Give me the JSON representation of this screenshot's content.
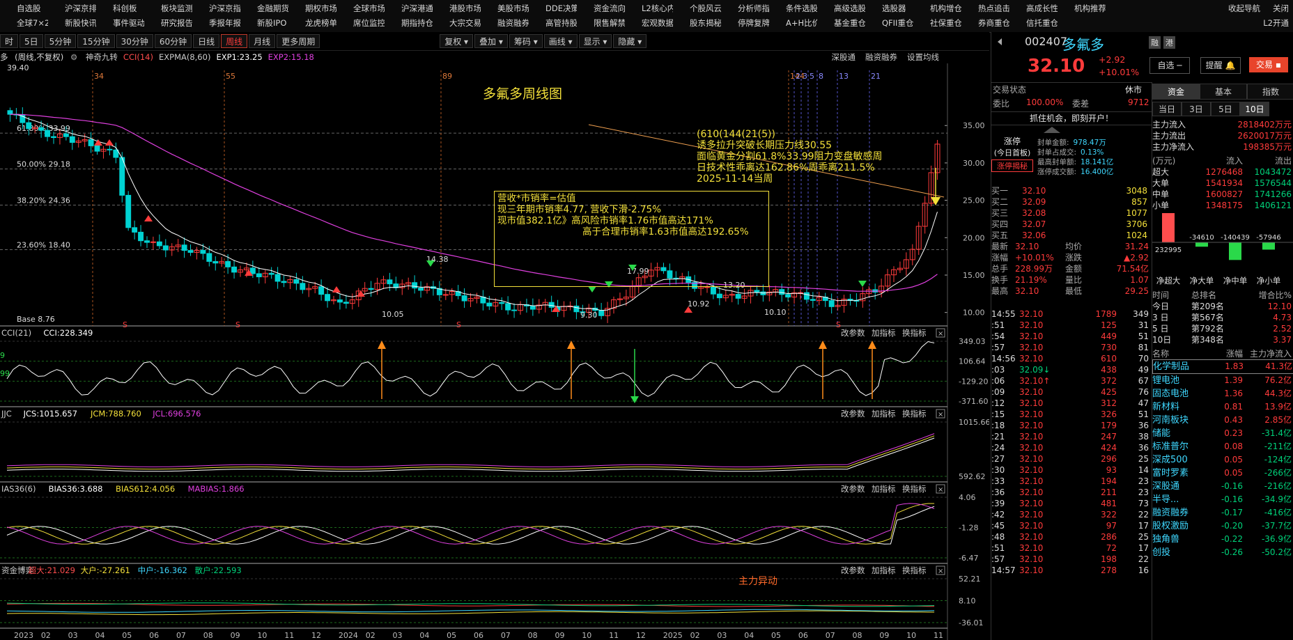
{
  "menu": {
    "row1": [
      "自选股",
      "沪深京排行",
      "科创板",
      "板块监测",
      "沪深京指数",
      "金融期货",
      "期权市场",
      "全球市场",
      "沪深港通",
      "港股市场",
      "美股市场",
      "DDE决策",
      "资金流向",
      "L2核心内参",
      "个股风云",
      "分析师指数",
      "条件选股",
      "高级选股",
      "选股器",
      "机构增仓",
      "热点追击",
      "高成长性",
      "机构推荐"
    ],
    "row2": [
      "全球7×24",
      "新股快讯",
      "事件驱动",
      "研究报告",
      "季报年报",
      "新股IPO",
      "龙虎榜单",
      "席位监控",
      "期指持仓",
      "大宗交易",
      "融资融券",
      "高管持股",
      "限售解禁",
      "宏观数据",
      "股东揭秘",
      "停牌复牌",
      "A+H比价",
      "基金重仓",
      "QFII重仓",
      "社保重仓",
      "券商重仓",
      "信托重仓"
    ],
    "right1": [
      "收起导航",
      "关闭"
    ],
    "right2": [
      "L2开通"
    ]
  },
  "periods": [
    "时",
    "5日",
    "5分钟",
    "15分钟",
    "30分钟",
    "60分钟",
    "日线",
    "周线",
    "月线",
    "更多周期"
  ],
  "active_period": "周线",
  "tools": [
    "复权",
    "叠加",
    "筹码",
    "画线",
    "显示",
    "隐藏"
  ],
  "main_indicator": {
    "stock_short": "多",
    "mode": "(周线,不复权)",
    "items": [
      {
        "text": "神奇九转",
        "color": "#cccccc"
      },
      {
        "text": "CCI(14)",
        "color": "#ff4d4d"
      },
      {
        "text": "EXPMA(8,60)",
        "color": "#cccccc"
      },
      {
        "text": "EXP1:23.25",
        "color": "#ffffff"
      },
      {
        "text": "EXP2:15.18",
        "color": "#e040e0"
      }
    ],
    "links": [
      "深股通",
      "融资融券",
      "设置均线"
    ]
  },
  "chart_title": "多氟多周线图",
  "annotation_box": {
    "lines": [
      "营收*市销率=估值",
      "现三年期市销率4.77, 营收下滑-2.75%",
      "现市值382.1亿》高风险市销率1.76市值高达171%",
      "高于合理市销率1.63市值高达192.65%"
    ]
  },
  "analysis_text": [
    "(610(144(21(5))",
    "诱多拉升突破长期压力线30.55",
    "面临黄金分割61.8%33.99阻力变盘敏感周",
    "日技术性乖离达162.86%周乖离211.5%",
    "2025-11-14当周"
  ],
  "fib_levels": [
    {
      "label": "61.80% 33.99",
      "value": 33.99
    },
    {
      "label": "50.00% 29.18",
      "value": 29.18
    },
    {
      "label": "38.20% 24.36",
      "value": 24.36
    },
    {
      "label": "23.60% 18.40",
      "value": 18.4
    }
  ],
  "fib_top_label": "39.40",
  "base_label": "Base  8.76",
  "price_axis": [
    "35.00",
    "30.00",
    "25.00",
    "20.00",
    "15.00",
    "10.00"
  ],
  "fib_numbers": [
    "34",
    "55",
    "89",
    "144",
    "2",
    "3",
    "5",
    "8",
    "13",
    "21"
  ],
  "candle_marks": [
    "10.05",
    "14.38",
    "9.30",
    "17.99",
    "10.92",
    "13.20",
    "10.10"
  ],
  "panels": [
    {
      "name": "CCI",
      "items": [
        {
          "text": "CCI(21)",
          "color": "#cccccc"
        },
        {
          "text": "CCI:228.349",
          "color": "#ffffff"
        }
      ],
      "axis": [
        "349.03",
        "106.64",
        "-129.20",
        "-371.60"
      ],
      "left_labels": [
        "9",
        "99"
      ]
    },
    {
      "name": "JCS",
      "items": [
        {
          "text": "JJC",
          "color": "#cccccc"
        },
        {
          "text": "JCS:1015.657",
          "color": "#ffffff"
        },
        {
          "text": "JCM:788.760",
          "color": "#f3e03a"
        },
        {
          "text": "JCL:696.576",
          "color": "#e040e0"
        }
      ],
      "axis": [
        "1015.66",
        "592.62"
      ]
    },
    {
      "name": "BIAS",
      "items": [
        {
          "text": "IAS36(6)",
          "color": "#cccccc"
        },
        {
          "text": "BIAS36:3.688",
          "color": "#ffffff"
        },
        {
          "text": "BIAS612:4.056",
          "color": "#f3e03a"
        },
        {
          "text": "MABIAS:1.866",
          "color": "#e040e0"
        }
      ],
      "axis": [
        "4.06",
        "-1.28",
        "-6.47"
      ]
    },
    {
      "name": "资金博弈",
      "items": [
        {
          "text": "资金博弈",
          "color": "#cccccc"
        },
        {
          "text": "超大:21.029",
          "color": "#ff4d4d"
        },
        {
          "text": "大户:-27.261",
          "color": "#f3e03a"
        },
        {
          "text": "中户:-16.362",
          "color": "#3fd8ff"
        },
        {
          "text": "散户:22.593",
          "color": "#00d27a"
        }
      ],
      "axis": [
        "52.21",
        "8.10",
        "-36.01"
      ],
      "annotation": "主力异动"
    }
  ],
  "panel_tools": [
    "改参数",
    "加指标",
    "换指标"
  ],
  "time_axis": [
    "2023",
    "02",
    "03",
    "04",
    "05",
    "06",
    "07",
    "08",
    "09",
    "10",
    "11",
    "12",
    "2024",
    "02",
    "03",
    "04",
    "05",
    "06",
    "07",
    "08",
    "09",
    "10",
    "11",
    "12",
    "2025",
    "02",
    "03",
    "04",
    "05",
    "06",
    "07",
    "08",
    "09",
    "10",
    "11"
  ],
  "quote": {
    "code": "002407",
    "name": "多氟多",
    "badges": [
      "融",
      "港"
    ],
    "price": "32.10",
    "change": "+2.92",
    "pct": "+10.01%",
    "watch_btn": "自选 ─",
    "alert_btn": "提醒",
    "trade_btn": "交易",
    "status_label": "交易状态",
    "status_value": "休市",
    "weibi_label": "委比",
    "weibi_value": "100.00%",
    "weicha_label": "委差",
    "weicha_value": "9712",
    "promo": "抓住机会，即刻开户！",
    "limit_title": "涨停",
    "limit_sub": "(今日首板)",
    "limit_btn": "涨停揭秘",
    "seal_info": [
      {
        "k": "封单金额:",
        "v": "978.47万"
      },
      {
        "k": "封单占成交:",
        "v": "0.13%"
      },
      {
        "k": "最高封单额:",
        "v": "18.141亿"
      },
      {
        "k": "涨停成交额:",
        "v": "16.400亿"
      }
    ],
    "bids": [
      {
        "l": "买一",
        "p": "32.10",
        "v": "3048"
      },
      {
        "l": "买二",
        "p": "32.09",
        "v": "857"
      },
      {
        "l": "买三",
        "p": "32.08",
        "v": "1077"
      },
      {
        "l": "买四",
        "p": "32.07",
        "v": "3706"
      },
      {
        "l": "买五",
        "p": "32.06",
        "v": "1024"
      }
    ],
    "stats": [
      {
        "k1": "最新",
        "v1": "32.10",
        "k2": "均价",
        "v2": "31.24"
      },
      {
        "k1": "涨幅",
        "v1": "+10.01%",
        "k2": "涨跌",
        "v2": "▲2.92"
      },
      {
        "k1": "总手",
        "v1": "228.99万",
        "k2": "金额",
        "v2": "71.54亿"
      },
      {
        "k1": "换手",
        "v1": "21.19%",
        "k2": "量比",
        "v2": "1.07"
      },
      {
        "k1": "最高",
        "v1": "32.10",
        "k2": "最低",
        "v2": "29.25"
      }
    ],
    "ticks": [
      {
        "t": "14:55",
        "p": "32.10",
        "v": "1789",
        "n": "349"
      },
      {
        "t": ":51",
        "p": "32.10",
        "v": "125",
        "n": "31"
      },
      {
        "t": ":54",
        "p": "32.10",
        "v": "449",
        "n": "51"
      },
      {
        "t": ":57",
        "p": "32.10",
        "v": "730",
        "n": "81"
      },
      {
        "t": "14:56",
        "p": "32.10",
        "v": "610",
        "n": "70"
      },
      {
        "t": ":03",
        "p": "32.09↓",
        "v": "438",
        "n": "49"
      },
      {
        "t": ":06",
        "p": "32.10↑",
        "v": "372",
        "n": "67"
      },
      {
        "t": ":09",
        "p": "32.10",
        "v": "425",
        "n": "76"
      },
      {
        "t": ":12",
        "p": "32.10",
        "v": "312",
        "n": "47"
      },
      {
        "t": ":15",
        "p": "32.10",
        "v": "326",
        "n": "51"
      },
      {
        "t": ":18",
        "p": "32.10",
        "v": "179",
        "n": "36"
      },
      {
        "t": ":21",
        "p": "32.10",
        "v": "247",
        "n": "38"
      },
      {
        "t": ":24",
        "p": "32.10",
        "v": "424",
        "n": "36"
      },
      {
        "t": ":27",
        "p": "32.10",
        "v": "296",
        "n": "25"
      },
      {
        "t": ":30",
        "p": "32.10",
        "v": "93",
        "n": "14"
      },
      {
        "t": ":33",
        "p": "32.10",
        "v": "194",
        "n": "23"
      },
      {
        "t": ":36",
        "p": "32.10",
        "v": "211",
        "n": "23"
      },
      {
        "t": ":39",
        "p": "32.10",
        "v": "481",
        "n": "73"
      },
      {
        "t": ":42",
        "p": "32.10",
        "v": "322",
        "n": "22"
      },
      {
        "t": ":45",
        "p": "32.10",
        "v": "97",
        "n": "17"
      },
      {
        "t": ":48",
        "p": "32.10",
        "v": "286",
        "n": "25"
      },
      {
        "t": ":51",
        "p": "32.10",
        "v": "72",
        "n": "17"
      },
      {
        "t": ":57",
        "p": "32.10",
        "v": "198",
        "n": "22"
      },
      {
        "t": "14:57",
        "p": "32.10",
        "v": "278",
        "n": "16"
      }
    ],
    "tabs": [
      "资金",
      "基本",
      "指数"
    ],
    "sub_tabs": [
      "当日",
      "3日",
      "5日",
      "10日"
    ],
    "flow": [
      {
        "k": "主力流入",
        "v": "2818402万元"
      },
      {
        "k": "主力流出",
        "v": "2620017万元"
      },
      {
        "k": "主力净流入",
        "v": "198385万元"
      }
    ],
    "flow_head": [
      "(万元)",
      "流入",
      "流出"
    ],
    "flow_table": [
      {
        "k": "超大",
        "a": "1276468",
        "b": "1043472"
      },
      {
        "k": "大单",
        "a": "1541934",
        "b": "1576544"
      },
      {
        "k": "中单",
        "a": "1600827",
        "b": "1741266"
      },
      {
        "k": "小单",
        "a": "1348175",
        "b": "1406121"
      }
    ],
    "net_bars": [
      {
        "label": "净超大",
        "value": 232995,
        "text": "232995"
      },
      {
        "label": "净大单",
        "value": -34610,
        "text": "-34610"
      },
      {
        "label": "净中单",
        "value": -140439,
        "text": "-140439"
      },
      {
        "label": "净小单",
        "value": -57946,
        "text": "-57946"
      }
    ],
    "rank_head": [
      "时间",
      "总排名",
      "增合比%"
    ],
    "ranks": [
      {
        "t": "今日",
        "r": "第209名",
        "p": "12.10"
      },
      {
        "t": "3 日",
        "r": "第567名",
        "p": "4.73"
      },
      {
        "t": "5 日",
        "r": "第792名",
        "p": "2.52"
      },
      {
        "t": "10日",
        "r": "第348名",
        "p": "3.37"
      }
    ],
    "sector_head": [
      "名称",
      "涨幅",
      "主力净流入"
    ],
    "sectors": [
      {
        "n": "化学制品",
        "p": "1.83",
        "f": "41.3亿",
        "hl": true
      },
      {
        "n": "锂电池",
        "p": "1.39",
        "f": "76.2亿"
      },
      {
        "n": "固态电池",
        "p": "1.36",
        "f": "44.3亿"
      },
      {
        "n": "新材料",
        "p": "0.81",
        "f": "13.9亿"
      },
      {
        "n": "河南板块",
        "p": "0.43",
        "f": "2.85亿"
      },
      {
        "n": "储能",
        "p": "0.23",
        "f": "-31.4亿"
      },
      {
        "n": "标准普尔",
        "p": "0.08",
        "f": "-211亿"
      },
      {
        "n": "深成500",
        "p": "0.05",
        "f": "-124亿"
      },
      {
        "n": "富时罗素",
        "p": "0.05",
        "f": "-266亿"
      },
      {
        "n": "深股通",
        "p": "-0.16",
        "f": "-216亿"
      },
      {
        "n": "半导...",
        "p": "-0.16",
        "f": "-34.9亿"
      },
      {
        "n": "融资融券",
        "p": "-0.17",
        "f": "-416亿"
      },
      {
        "n": "股权激励",
        "p": "-0.20",
        "f": "-37.7亿"
      },
      {
        "n": "独角兽",
        "p": "-0.22",
        "f": "-36.9亿"
      },
      {
        "n": "创投",
        "p": "-0.26",
        "f": "-50.2亿"
      }
    ]
  },
  "colors": {
    "up": "#ff3b3b",
    "down": "#00d2d2",
    "accent": "#f3e03a",
    "ma": "#e040e0"
  }
}
